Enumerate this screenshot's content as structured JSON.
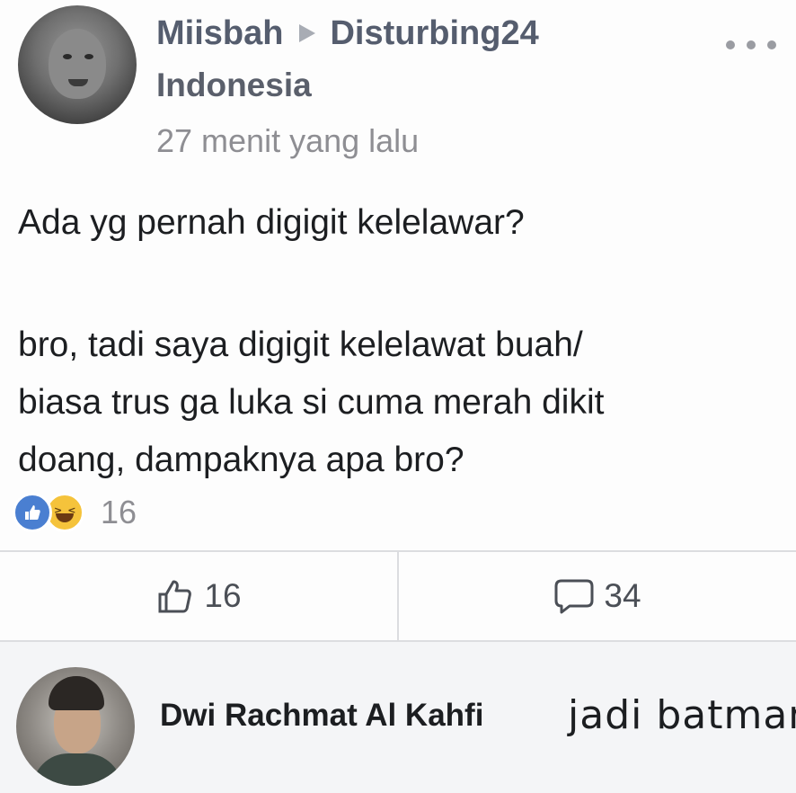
{
  "post": {
    "author_name": "Miisbah",
    "target_name": "Disturbing24",
    "location": "Indonesia",
    "timestamp": "27 menit yang lalu",
    "body": {
      "line1": "Ada yg pernah digigit kelelawar?",
      "line2": "bro, tadi saya digigit kelelawat buah/",
      "line3": "biasa trus ga luka si cuma merah dikit",
      "line4": "doang, dampaknya apa bro?"
    },
    "reactions": {
      "types": [
        "like",
        "haha"
      ],
      "count": "16"
    },
    "actions": {
      "like_count": "16",
      "comment_count": "34"
    }
  },
  "comment": {
    "author": "Dwi Rachmat Al Kahfi",
    "text": "jadi batman"
  },
  "colors": {
    "like_blue": "#4a7fd1",
    "haha_yellow": "#f5c33b",
    "name_gray": "#555d6e",
    "meta_gray": "#8e8e93"
  },
  "icons": [
    "more-icon",
    "arrow-right-icon",
    "like-reaction-icon",
    "haha-reaction-icon",
    "thumbs-up-icon",
    "comment-bubble-icon"
  ]
}
